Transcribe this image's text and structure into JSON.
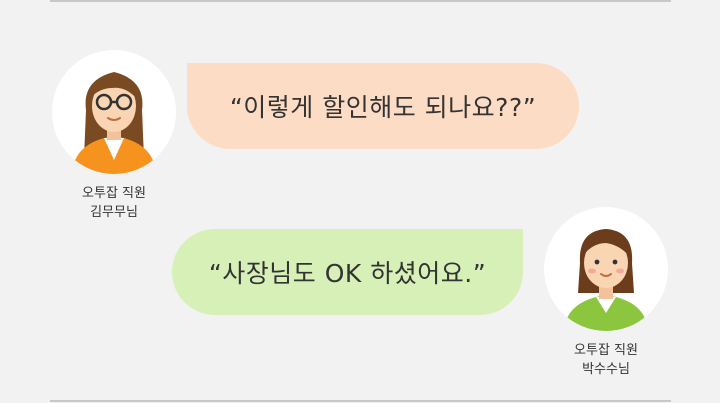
{
  "conversation": {
    "message1": {
      "text": "“이렇게 할인해도 되나요??”",
      "speaker_line1": "오투잡 직원",
      "speaker_line2": "김무무님",
      "bubble_color": "#fddcc5"
    },
    "message2": {
      "text": "“사장님도 OK 하셨어요.”",
      "speaker_line1": "오투잡 직원",
      "speaker_line2": "박수수님",
      "bubble_color": "#d7f0b8"
    }
  },
  "icons": {
    "avatar1": "woman-glasses-orange-avatar-icon",
    "avatar2": "woman-green-avatar-icon"
  }
}
